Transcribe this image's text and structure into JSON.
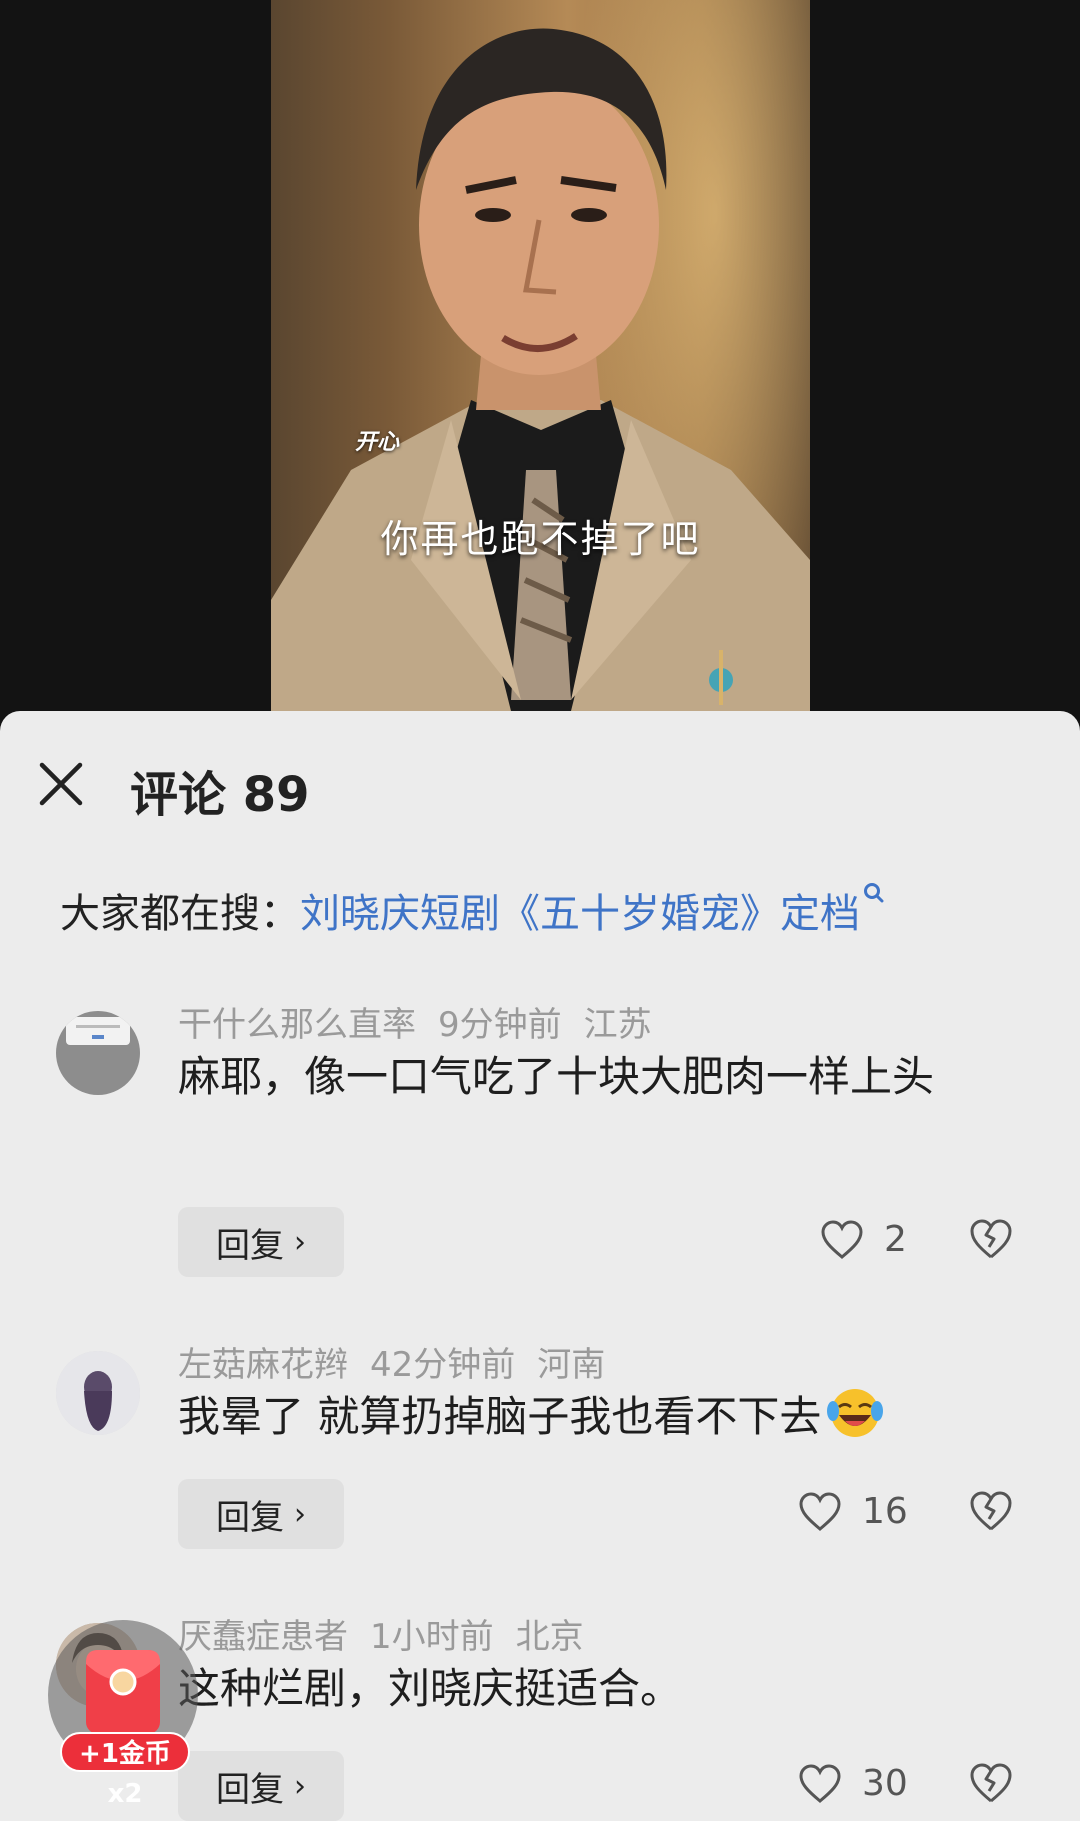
{
  "video": {
    "sticker_text": "开心",
    "subtitle": "你再也跑不掉了吧"
  },
  "comments_panel": {
    "title": "评论 89",
    "search_prefix": "大家都在搜：",
    "search_link": "刘晓庆短剧《五十岁婚宠》定档",
    "reply_label": "回复",
    "comments": [
      {
        "username": "干什么那么直率",
        "time": "9分钟前",
        "location": "江苏",
        "text": "麻耶，像一口气吃了十块大肥肉一样上头",
        "likes": "2"
      },
      {
        "username": "左菇麻花辫",
        "time": "42分钟前",
        "location": "河南",
        "text": "我晕了 就算扔掉脑子我也看不下去",
        "likes": "16"
      },
      {
        "username": "厌蠢症患者",
        "time": "1小时前",
        "location": "北京",
        "text": "这种烂剧，刘晓庆挺适合。",
        "likes": "30"
      }
    ]
  },
  "floating_coin": {
    "badge": "+1金币x2"
  },
  "colors": {
    "sheet_bg": "#ececec",
    "link_blue": "#3f74c7",
    "badge_red": "#ec2f3a"
  }
}
